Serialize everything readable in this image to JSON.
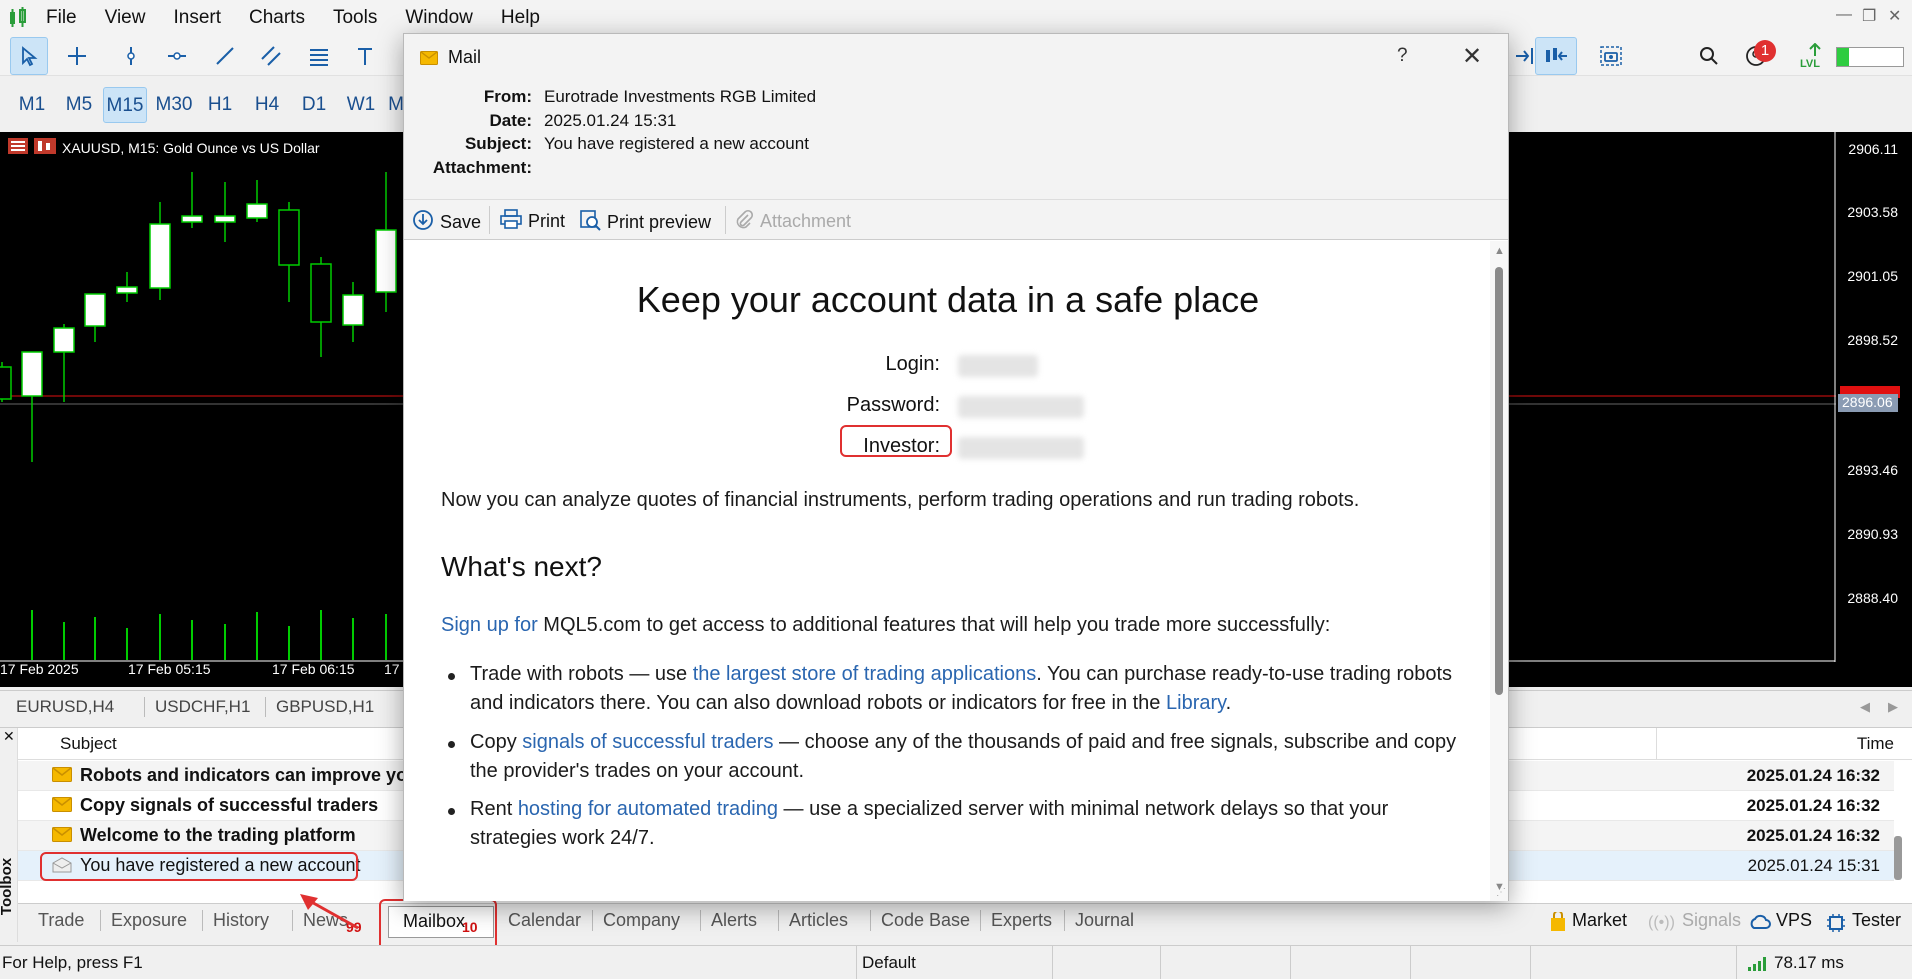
{
  "menu": {
    "items": [
      "File",
      "View",
      "Insert",
      "Charts",
      "Tools",
      "Window",
      "Help"
    ]
  },
  "timeframes": {
    "items": [
      "M1",
      "M5",
      "M15",
      "M30",
      "H1",
      "H4",
      "D1",
      "W1",
      "M"
    ],
    "active": "M15"
  },
  "toolbar_right": {
    "notification_count": "1",
    "lvl_label": "LVL"
  },
  "chart": {
    "title": "XAUUSD, M15:  Gold Ounce vs US Dollar",
    "prices": [
      "2906.11",
      "2903.58",
      "2901.05",
      "2898.52",
      "2896.06",
      "2893.46",
      "2890.93",
      "2888.40"
    ],
    "current_price": "2896.06",
    "times": [
      "17 Feb 2025",
      "17 Feb 05:15",
      "17 Feb 06:15",
      "17"
    ]
  },
  "chart_tabs": [
    "EURUSD,H4",
    "USDCHF,H1",
    "GBPUSD,H1"
  ],
  "mailbox": {
    "col_subject": "Subject",
    "col_time": "Time",
    "rows": [
      {
        "subject": "Robots and indicators can improve yo",
        "time": "2025.01.24 16:32",
        "unread": true
      },
      {
        "subject": "Copy signals of successful traders",
        "time": "2025.01.24 16:32",
        "unread": true
      },
      {
        "subject": "Welcome to the trading platform",
        "time": "2025.01.24 16:32",
        "unread": true
      },
      {
        "subject": "You have registered a new account",
        "time": "2025.01.24 15:31",
        "unread": false
      }
    ]
  },
  "toolbox": {
    "side_label": "Toolbox",
    "tabs": [
      "Trade",
      "Exposure",
      "History",
      "News",
      "Mailbox",
      "Calendar",
      "Company",
      "Alerts",
      "Articles",
      "Code Base",
      "Experts",
      "Journal"
    ],
    "news_badge": "99",
    "mailbox_badge": "10",
    "right_items": [
      "Market",
      "Signals",
      "VPS",
      "Tester"
    ]
  },
  "status": {
    "help": "For Help, press F1",
    "profile": "Default",
    "ping": "78.17 ms"
  },
  "mail_dialog": {
    "title": "Mail",
    "help_btn": "?",
    "from_label": "From:",
    "from_value": "Eurotrade Investments RGB Limited",
    "date_label": "Date:",
    "date_value": "2025.01.24 15:31",
    "subject_label": "Subject:",
    "subject_value": "You have registered a new account",
    "attachment_label": "Attachment:",
    "actions": {
      "save": "Save",
      "print": "Print",
      "print_preview": "Print preview",
      "attachment": "Attachment"
    },
    "heading": "Keep your account data in a safe place",
    "login_label": "Login:",
    "password_label": "Password:",
    "investor_label": "Investor:",
    "intro": "Now you can analyze quotes of financial instruments, perform trading operations and run trading robots.",
    "whats_next": "What's next?",
    "signup_link": "Sign up for",
    "signup_rest": " MQL5.com to get access to additional features that will help you trade more successfully:",
    "b1_a": "Trade with robots — use ",
    "b1_link": "the largest store of trading applications",
    "b1_b": ". You can purchase ready-to-use trading robots",
    "b1_c": "and indicators there. You can also download robots or indicators for free in the ",
    "b1_link2": "Library",
    "b1_d": ".",
    "b2_a": "Copy ",
    "b2_link": "signals of successful traders",
    "b2_b": " — choose any of the thousands of paid and free signals, subscribe and copy",
    "b2_c": "the provider's trades on your account.",
    "b3_a": "Rent ",
    "b3_link": "hosting for automated trading",
    "b3_b": " — use a specialized server with minimal network delays so that your",
    "b3_c": "strategies work 24/7."
  },
  "colors": {
    "accent": "#2a66b0",
    "annotation_red": "#e03030",
    "chart_bg": "#000000",
    "candle_green": "#00cc00"
  }
}
